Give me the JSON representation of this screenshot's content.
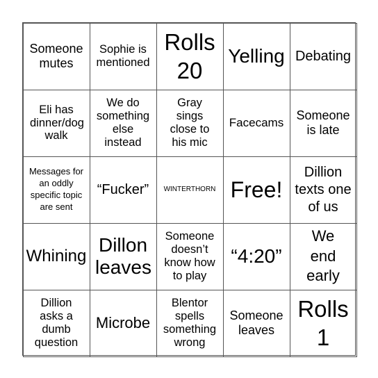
{
  "cells": [
    "Someone mutes",
    "Sophie is mentioned",
    "Rolls 20",
    "Yelling",
    "Debating",
    "Eli has dinner/dog walk",
    "We do something else instead",
    "Gray sings close to his mic",
    "Facecams",
    "Someone is late",
    "Messages for an oddly specific topic are sent",
    "“Fucker”",
    "WINTERTHORN",
    "Free!",
    "Dillion texts one of us",
    "Whining",
    "Dillon leaves",
    "Someone doesn’t know how to play",
    "“4:20”",
    "We end early",
    "Dillion asks a dumb question",
    "Microbe",
    "Blentor spells something wrong",
    "Someone leaves",
    "Rolls 1"
  ]
}
